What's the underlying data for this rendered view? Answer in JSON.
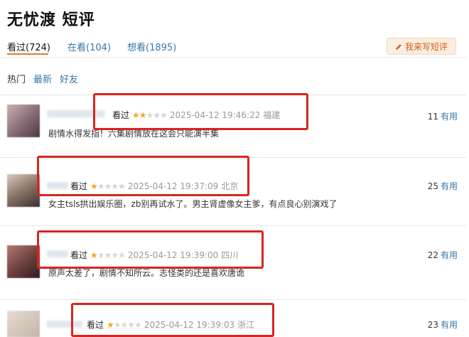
{
  "page": {
    "title": "无忧渡 短评"
  },
  "tabs": [
    {
      "label": "看过(724)"
    },
    {
      "label": "在看(104)"
    },
    {
      "label": "想看(1895)"
    }
  ],
  "write_button": {
    "label": "我来写短评",
    "icon": "pencil-icon"
  },
  "sorts": [
    {
      "label": "热门"
    },
    {
      "label": "最新"
    },
    {
      "label": "好友"
    }
  ],
  "colors": {
    "link": "#3377aa",
    "star": "#f5a623",
    "highlight_box": "#d9241f",
    "write_button_bg": "#fbeee0",
    "write_button_text": "#d35d13"
  },
  "comments": [
    {
      "status": "看过",
      "rating": 2,
      "time": "2025-04-12 19:46:22",
      "location": "福建",
      "text": "剧情水得发指！六集剧情放在这会只能演半集",
      "useful_count": "11",
      "useful_label": "有用"
    },
    {
      "status": "看过",
      "rating": 1,
      "time": "2025-04-12 19:37:09",
      "location": "北京",
      "text": "女主tsls拱出娱乐圈，zb别再试水了。男主肾虚像女主爹，有点良心别演戏了",
      "useful_count": "25",
      "useful_label": "有用"
    },
    {
      "status": "看过",
      "rating": 1,
      "time": "2025-04-12 19:39:00",
      "location": "四川",
      "text": "原声太差了，剧情不知所云。志怪类的还是喜欢唐诡",
      "useful_count": "22",
      "useful_label": "有用"
    },
    {
      "status": "看过",
      "rating": 1,
      "time": "2025-04-12 19:39:03",
      "location": "浙江",
      "text": "",
      "useful_count": "23",
      "useful_label": "有用"
    }
  ]
}
